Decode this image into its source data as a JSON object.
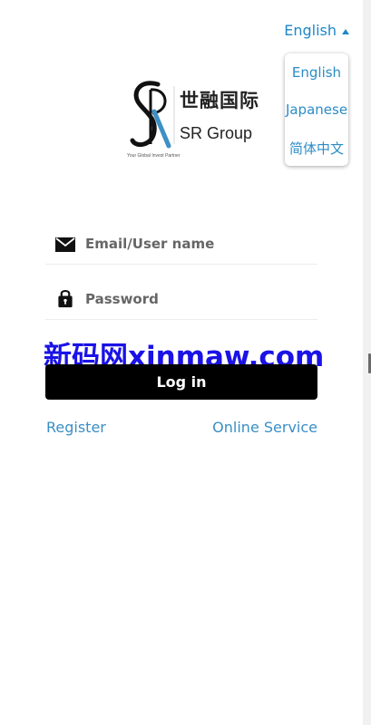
{
  "language": {
    "current": "English",
    "options": [
      "English",
      "Japanese",
      "简体中文"
    ]
  },
  "logo": {
    "chinese": "世融国际",
    "english": "SR Group",
    "tagline": "Your Global Invest Partner"
  },
  "login": {
    "email_placeholder": "Email/User name",
    "password_placeholder": "Password",
    "button": "Log in"
  },
  "watermark": "新码网xinmaw.com",
  "links": {
    "register": "Register",
    "service": "Online Service"
  },
  "icons": {
    "email": "envelope-icon",
    "password": "lock-icon",
    "language": "caret-up-icon"
  },
  "colors": {
    "accent": "#1e88c9",
    "button": "#000000",
    "watermark": "#1a12e6"
  }
}
